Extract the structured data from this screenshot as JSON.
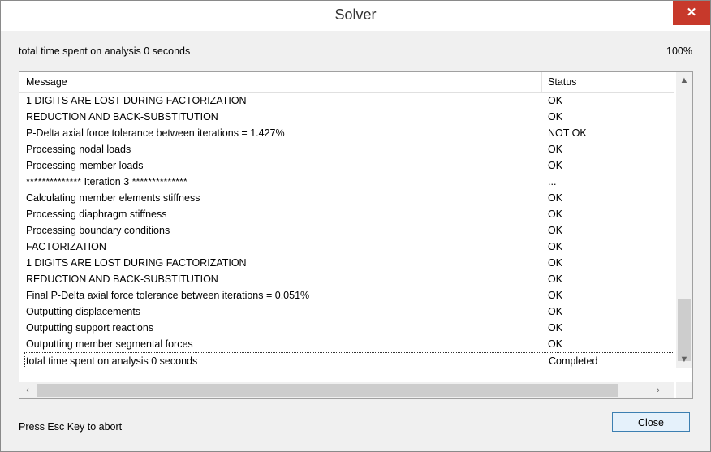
{
  "window": {
    "title": "Solver",
    "close_glyph": "✕"
  },
  "status": {
    "text": "total time spent on analysis 0 seconds",
    "percent": "100%"
  },
  "grid": {
    "columns": [
      "Message",
      "Status"
    ],
    "rows": [
      {
        "message": "1 DIGITS ARE LOST DURING FACTORIZATION",
        "status": "OK"
      },
      {
        "message": "REDUCTION AND BACK-SUBSTITUTION",
        "status": "OK"
      },
      {
        "message": "P-Delta axial force tolerance between iterations = 1.427%",
        "status": "NOT OK"
      },
      {
        "message": "Processing nodal loads",
        "status": "OK"
      },
      {
        "message": "Processing member loads",
        "status": "OK"
      },
      {
        "message": "************** Iteration 3 **************",
        "status": "..."
      },
      {
        "message": "Calculating member elements stiffness",
        "status": "OK"
      },
      {
        "message": "Processing diaphragm stiffness",
        "status": "OK"
      },
      {
        "message": "Processing boundary conditions",
        "status": "OK"
      },
      {
        "message": "FACTORIZATION",
        "status": "OK"
      },
      {
        "message": "1 DIGITS ARE LOST DURING FACTORIZATION",
        "status": "OK"
      },
      {
        "message": "REDUCTION AND BACK-SUBSTITUTION",
        "status": "OK"
      },
      {
        "message": "Final P-Delta axial force tolerance between iterations = 0.051%",
        "status": "OK"
      },
      {
        "message": "Outputting displacements",
        "status": "OK"
      },
      {
        "message": "Outputting support reactions",
        "status": "OK"
      },
      {
        "message": "Outputting member segmental forces",
        "status": "OK"
      },
      {
        "message": "total time spent on analysis 0 seconds",
        "status": "Completed"
      }
    ]
  },
  "footer": {
    "abort_text": "Press Esc Key to abort",
    "close_label": "Close"
  },
  "icons": {
    "scroll_up": "▲",
    "scroll_down": "▼",
    "scroll_left": "‹",
    "scroll_right": "›"
  }
}
